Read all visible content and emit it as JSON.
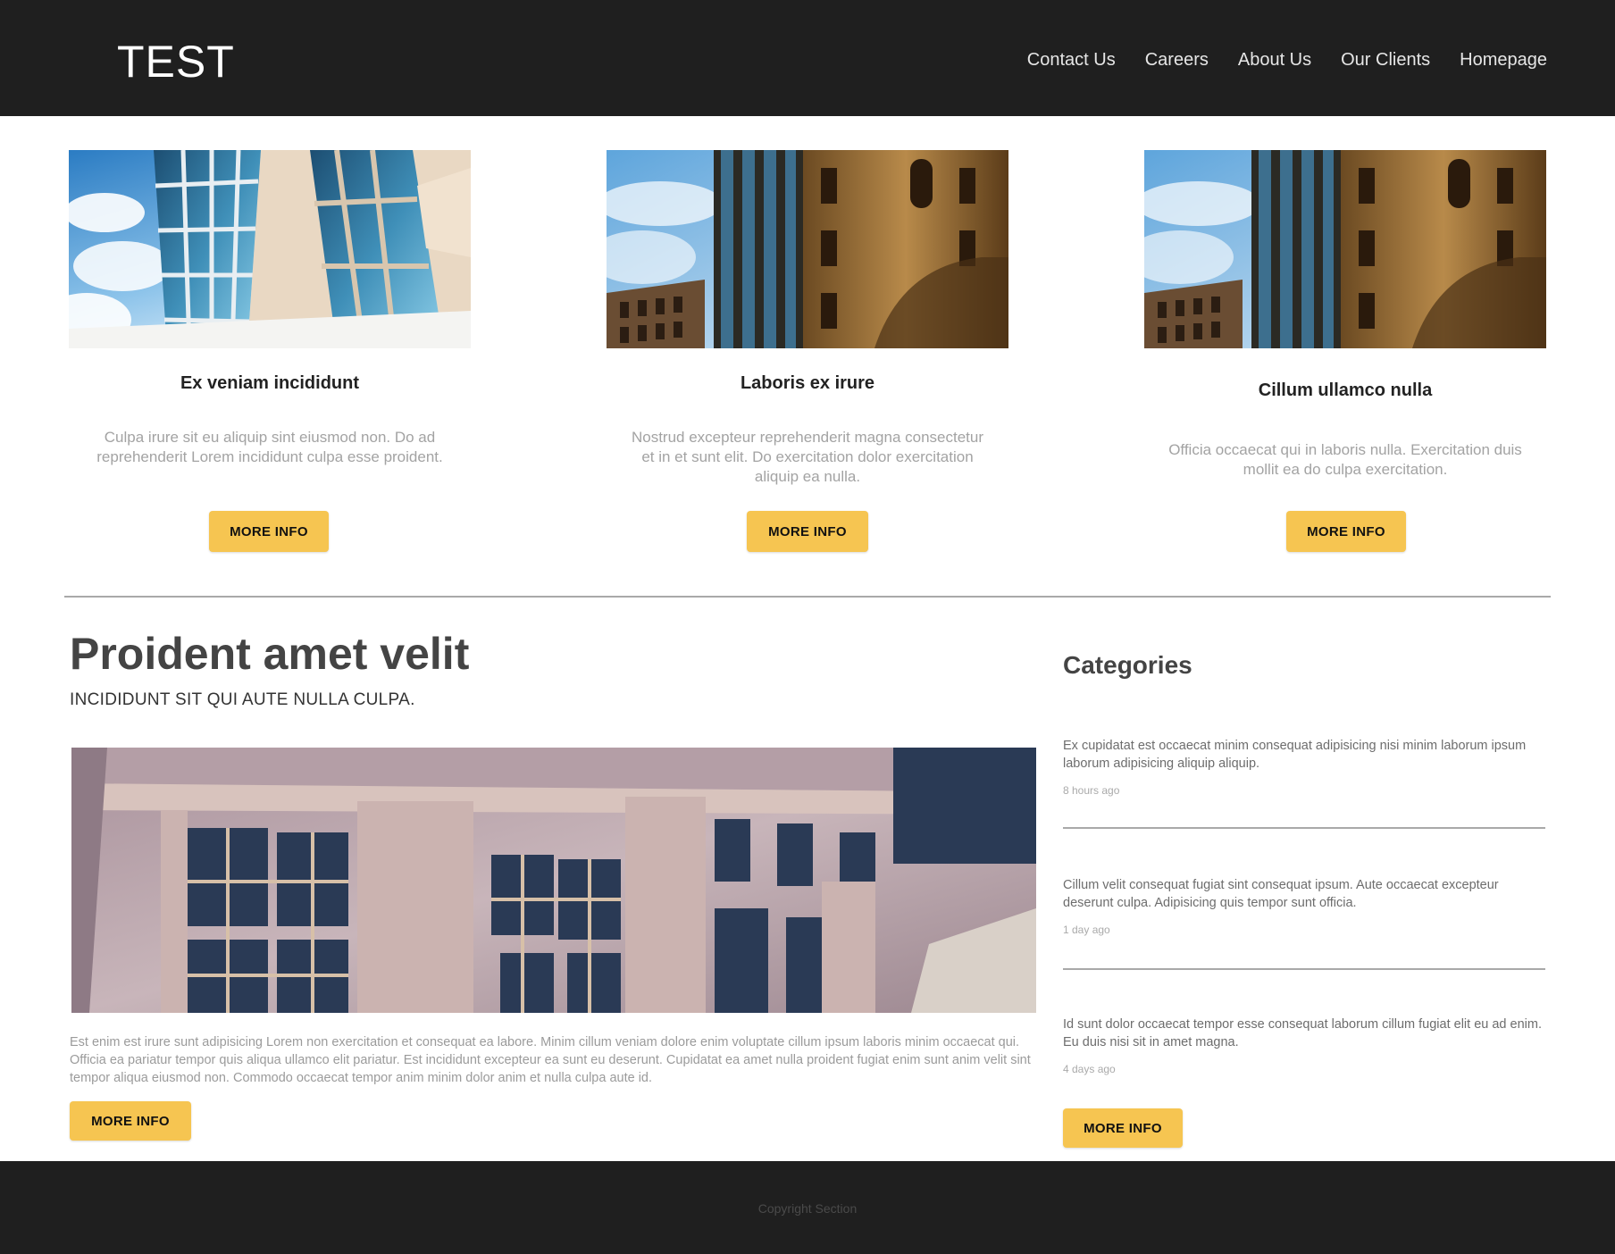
{
  "header": {
    "logo": "TEST",
    "nav": [
      "Contact Us",
      "Careers",
      "About Us",
      "Our Clients",
      "Homepage"
    ]
  },
  "cards": [
    {
      "title": "Ex veniam incididunt",
      "text": "Culpa irure sit eu aliquip sint eiusmod non. Do ad reprehenderit Lorem incididunt culpa esse proident.",
      "button": "MORE INFO"
    },
    {
      "title": "Laboris ex irure",
      "text": "Nostrud excepteur reprehenderit magna consectetur et in et sunt elit. Do exercitation dolor exercitation aliquip ea nulla.",
      "button": "MORE INFO"
    },
    {
      "title": "Cillum ullamco nulla",
      "text": "Officia occaecat qui in laboris nulla. Exercitation duis mollit ea do culpa exercitation.",
      "button": "MORE INFO"
    }
  ],
  "article": {
    "title": "Proident amet velit",
    "subtitle": "INCIDIDUNT SIT QUI AUTE NULLA CULPA.",
    "text": "Est enim est irure sunt adipisicing Lorem non exercitation et consequat ea labore. Minim cillum veniam dolore enim voluptate cillum ipsum laboris minim occaecat qui. Officia ea pariatur tempor quis aliqua ullamco elit pariatur. Est incididunt excepteur ea sunt eu deserunt. Cupidatat ea amet nulla proident fugiat enim sunt anim velit sint tempor aliqua eiusmod non. Commodo occaecat tempor anim minim dolor anim et nulla culpa aute id.",
    "button": "MORE INFO"
  },
  "sidebar": {
    "title": "Categories",
    "items": [
      {
        "text": "Ex cupidatat est occaecat minim consequat adipisicing nisi minim laborum ipsum laborum adipisicing aliquip aliquip.",
        "time": "8 hours ago"
      },
      {
        "text": "Cillum velit consequat fugiat sint consequat ipsum. Aute occaecat excepteur deserunt culpa. Adipisicing quis tempor sunt officia.",
        "time": "1 day ago"
      },
      {
        "text": "Id sunt dolor occaecat tempor esse consequat laborum cillum fugiat elit eu ad enim. Eu duis nisi sit in amet magna.",
        "time": "4 days ago"
      }
    ],
    "button": "MORE INFO"
  },
  "footer": {
    "text": "Copyright Section"
  },
  "colors": {
    "header_bg": "#1f1f1f",
    "button_bg": "#f6c551",
    "muted_text": "#a3a3a3"
  }
}
